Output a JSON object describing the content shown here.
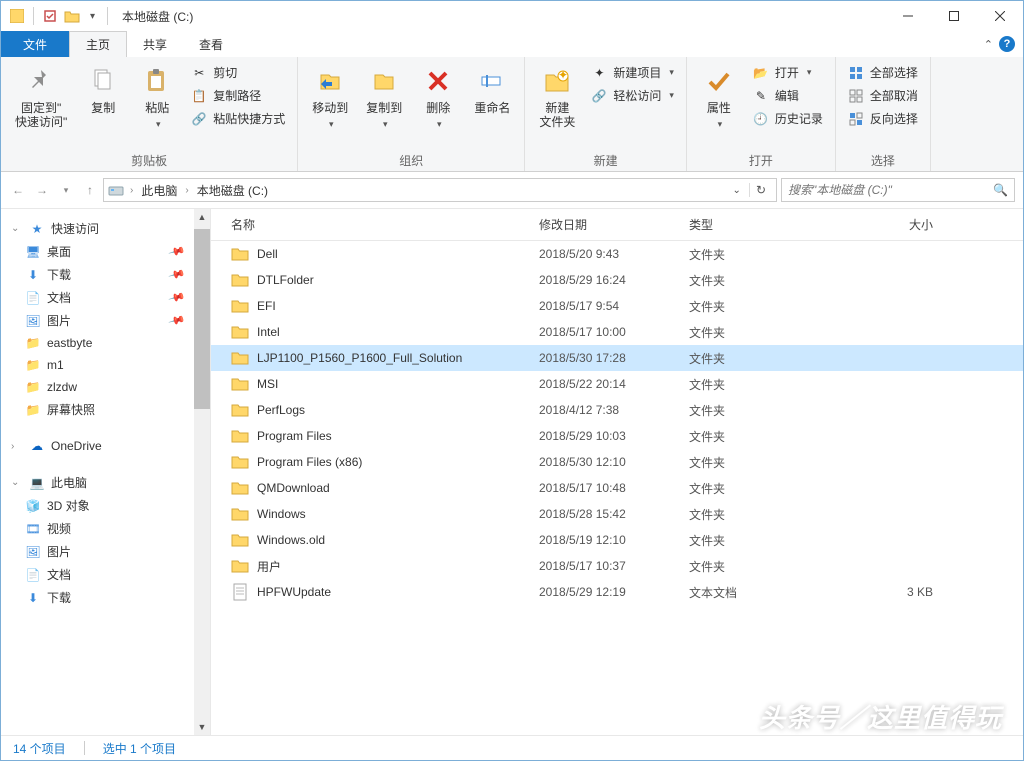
{
  "title": "本地磁盘 (C:)",
  "tabs": {
    "file": "文件",
    "home": "主页",
    "share": "共享",
    "view": "查看"
  },
  "ribbon": {
    "clipboard": {
      "label": "剪贴板",
      "pin": "固定到\"\n快速访问\"",
      "copy": "复制",
      "paste": "粘贴",
      "cut": "剪切",
      "copypath": "复制路径",
      "pasteshortcut": "粘贴快捷方式"
    },
    "organize": {
      "label": "组织",
      "moveto": "移动到",
      "copyto": "复制到",
      "delete": "删除",
      "rename": "重命名"
    },
    "new": {
      "label": "新建",
      "newfolder": "新建\n文件夹",
      "newitem": "新建项目",
      "easyaccess": "轻松访问"
    },
    "open": {
      "label": "打开",
      "properties": "属性",
      "open": "打开",
      "edit": "编辑",
      "history": "历史记录"
    },
    "select": {
      "label": "选择",
      "selectall": "全部选择",
      "selectnone": "全部取消",
      "invert": "反向选择"
    }
  },
  "breadcrumb": {
    "thispc": "此电脑",
    "drive": "本地磁盘 (C:)"
  },
  "search_placeholder": "搜索\"本地磁盘 (C:)\"",
  "nav": {
    "quickaccess": "快速访问",
    "desktop": "桌面",
    "downloads": "下载",
    "documents": "文档",
    "pictures": "图片",
    "eastbyte": "eastbyte",
    "m1": "m1",
    "zlzdw": "zlzdw",
    "screenshots": "屏幕快照",
    "onedrive": "OneDrive",
    "thispc": "此电脑",
    "3d": "3D 对象",
    "videos": "视频",
    "pictures2": "图片",
    "documents2": "文档",
    "downloads2": "下载"
  },
  "columns": {
    "name": "名称",
    "date": "修改日期",
    "type": "类型",
    "size": "大小"
  },
  "files": [
    {
      "name": "Dell",
      "date": "2018/5/20 9:43",
      "type": "文件夹",
      "size": "",
      "icon": "folder"
    },
    {
      "name": "DTLFolder",
      "date": "2018/5/29 16:24",
      "type": "文件夹",
      "size": "",
      "icon": "folder"
    },
    {
      "name": "EFI",
      "date": "2018/5/17 9:54",
      "type": "文件夹",
      "size": "",
      "icon": "folder"
    },
    {
      "name": "Intel",
      "date": "2018/5/17 10:00",
      "type": "文件夹",
      "size": "",
      "icon": "folder"
    },
    {
      "name": "LJP1100_P1560_P1600_Full_Solution",
      "date": "2018/5/30 17:28",
      "type": "文件夹",
      "size": "",
      "icon": "folder",
      "selected": true
    },
    {
      "name": "MSI",
      "date": "2018/5/22 20:14",
      "type": "文件夹",
      "size": "",
      "icon": "folder"
    },
    {
      "name": "PerfLogs",
      "date": "2018/4/12 7:38",
      "type": "文件夹",
      "size": "",
      "icon": "folder"
    },
    {
      "name": "Program Files",
      "date": "2018/5/29 10:03",
      "type": "文件夹",
      "size": "",
      "icon": "folder"
    },
    {
      "name": "Program Files (x86)",
      "date": "2018/5/30 12:10",
      "type": "文件夹",
      "size": "",
      "icon": "folder"
    },
    {
      "name": "QMDownload",
      "date": "2018/5/17 10:48",
      "type": "文件夹",
      "size": "",
      "icon": "folder"
    },
    {
      "name": "Windows",
      "date": "2018/5/28 15:42",
      "type": "文件夹",
      "size": "",
      "icon": "folder"
    },
    {
      "name": "Windows.old",
      "date": "2018/5/19 12:10",
      "type": "文件夹",
      "size": "",
      "icon": "folder"
    },
    {
      "name": "用户",
      "date": "2018/5/17 10:37",
      "type": "文件夹",
      "size": "",
      "icon": "folder"
    },
    {
      "name": "HPFWUpdate",
      "date": "2018/5/29 12:19",
      "type": "文本文档",
      "size": "3 KB",
      "icon": "txt"
    }
  ],
  "status": {
    "count": "14 个项目",
    "selected": "选中 1 个项目"
  },
  "watermark": "头条号／这里值得玩"
}
